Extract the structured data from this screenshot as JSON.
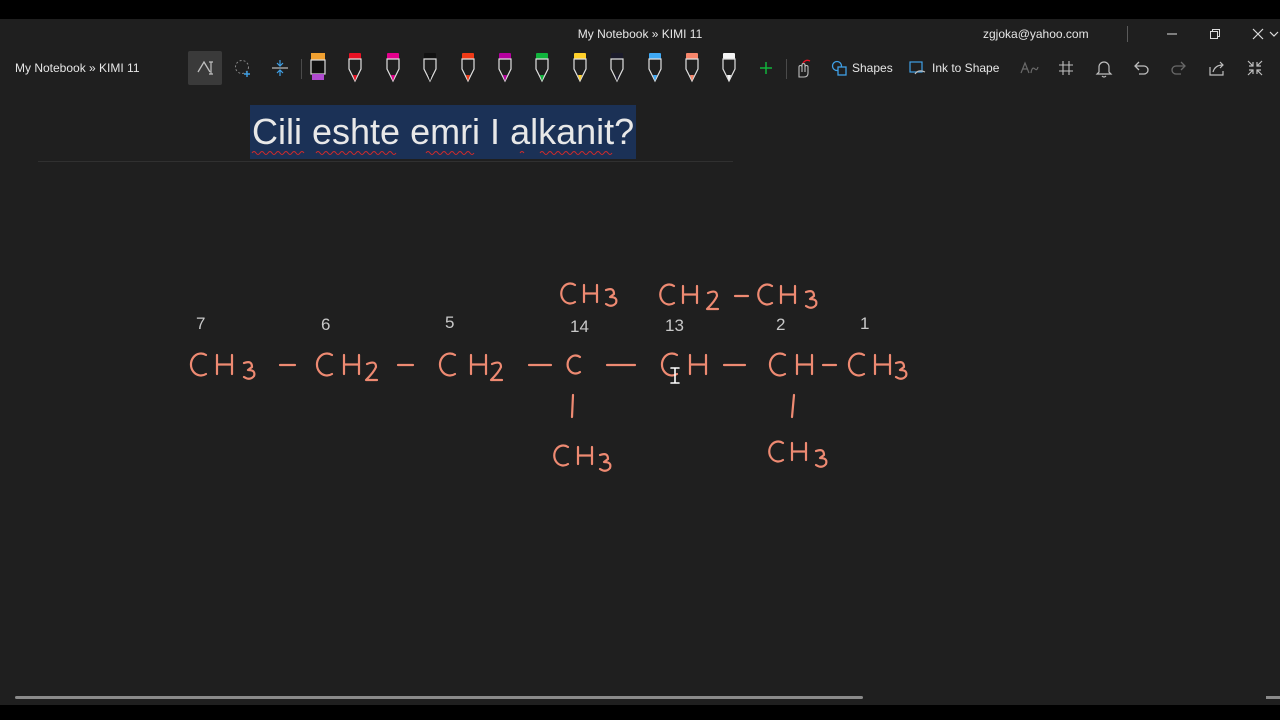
{
  "window": {
    "title": "My Notebook » KIMI 11",
    "account": "zgjoka@yahoo.com",
    "controls": {
      "minimize": "–",
      "restore": "❐",
      "close": "✕"
    }
  },
  "toolbar": {
    "breadcrumb": "My Notebook » KIMI 11",
    "shapes_label": "Shapes",
    "ink_to_shape_label": "Ink to Shape",
    "pens": [
      {
        "name": "pen-black-highlighter",
        "color": "#111111"
      },
      {
        "name": "pen-red",
        "color": "#e81123"
      },
      {
        "name": "pen-magenta",
        "color": "#e3008c"
      },
      {
        "name": "pen-black",
        "color": "#111111"
      },
      {
        "name": "pen-orange-red",
        "color": "#f03a17"
      },
      {
        "name": "pen-purple",
        "color": "#b4009e"
      },
      {
        "name": "pen-green",
        "color": "#10b43c"
      },
      {
        "name": "pen-yellow",
        "color": "#ffd02a"
      },
      {
        "name": "pen-dark",
        "color": "#1a1a2a"
      },
      {
        "name": "pen-light-blue",
        "color": "#3fa9f5"
      },
      {
        "name": "pen-salmon",
        "color": "#f7866b"
      },
      {
        "name": "pen-white",
        "color": "#f5f5f5"
      }
    ],
    "accent": "#3fa0e6"
  },
  "page": {
    "title": "Cili eshte emri I alkanit?"
  },
  "ink": {
    "color": "#ee8a72",
    "number_color": "#c8c8c8",
    "numbers": [
      "7",
      "6",
      "5",
      "14",
      "13",
      "2",
      "1"
    ]
  }
}
